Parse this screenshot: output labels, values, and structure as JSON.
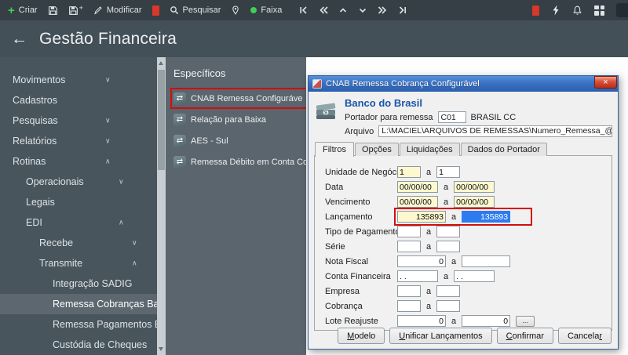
{
  "colors": {
    "toolbar-bg": "#353f45",
    "header-bg": "#445058",
    "sidebar-bg": "#49555d",
    "selected-bg": "#5c676f",
    "panel-bg": "#5b656d",
    "annotation": "#d40c0c",
    "selection": "#2e7bf0",
    "tint": "#fdf8cf",
    "bank-blue": "#1a55a8",
    "green": "#3ecf57",
    "red-badge": "#d8372a"
  },
  "icons": {
    "plus": "+",
    "back": "←",
    "close": "×",
    "chevron_down": "∨",
    "chevron_up": "∧",
    "transfer": "⇄"
  },
  "toolbar": {
    "criar": "Criar",
    "modificar": "Modificar",
    "pesquisar": "Pesquisar",
    "faixa": "Faixa"
  },
  "header": {
    "title": "Gestão Financeira"
  },
  "sidebar": {
    "items": [
      {
        "label": "Movimentos",
        "level": 0,
        "chevron": "down",
        "selected": false
      },
      {
        "label": "Cadastros",
        "level": 0,
        "chevron": "",
        "selected": false
      },
      {
        "label": "Pesquisas",
        "level": 0,
        "chevron": "down",
        "selected": false
      },
      {
        "label": "Relatórios",
        "level": 0,
        "chevron": "down",
        "selected": false
      },
      {
        "label": "Rotinas",
        "level": 0,
        "chevron": "up",
        "selected": false
      },
      {
        "label": "Operacionais",
        "level": 1,
        "chevron": "down",
        "selected": false
      },
      {
        "label": "Legais",
        "level": 1,
        "chevron": "",
        "selected": false
      },
      {
        "label": "EDI",
        "level": 1,
        "chevron": "up",
        "selected": false
      },
      {
        "label": "Recebe",
        "level": 2,
        "chevron": "down",
        "selected": false
      },
      {
        "label": "Transmite",
        "level": 2,
        "chevron": "up",
        "selected": false
      },
      {
        "label": "Integração SADIG",
        "level": 3,
        "chevron": "",
        "selected": false
      },
      {
        "label": "Remessa Cobranças Bancár",
        "level": 3,
        "chevron": "",
        "selected": true
      },
      {
        "label": "Remessa Pagamentos Banca",
        "level": 3,
        "chevron": "",
        "selected": false
      },
      {
        "label": "Custódia de Cheques",
        "level": 3,
        "chevron": "",
        "selected": false
      }
    ]
  },
  "specificos": {
    "title": "Específicos",
    "items": [
      {
        "label": "CNAB Remessa Configurável",
        "annotated": true
      },
      {
        "label": "Relação para Baixa",
        "annotated": false
      },
      {
        "label": "AES - Sul",
        "annotated": false
      },
      {
        "label": "Remessa Débito em Conta Configurável",
        "annotated": false
      }
    ]
  },
  "dialog": {
    "title": "CNAB Remessa Cobrança Configurável",
    "bank": "Banco do Brasil",
    "portador_label": "Portador para remessa",
    "portador_code": "C01",
    "portador_desc": "BRASIL CC",
    "arquivo_label": "Arquivo",
    "arquivo_value": "L:\\MACIEL\\ARQUIVOS DE REMESSAS\\Numero_Remessa_@R_Código_Banco_@B_Data_@Dddmmaa@",
    "tabs": [
      {
        "label": "Filtros",
        "active": true
      },
      {
        "label": "Opções",
        "active": false
      },
      {
        "label": "Liquidações",
        "active": false
      },
      {
        "label": "Dados do Portador",
        "active": false
      }
    ],
    "range_sep": "a",
    "browse_label": "...",
    "rows": [
      {
        "label": "Unidade de Negócio",
        "v1": "1",
        "v2": "1",
        "size": "xs",
        "tint1": true
      },
      {
        "label": "Data",
        "v1": "00/00/00",
        "v2": "00/00/00",
        "size": "sm",
        "tint1": true,
        "tint2": true
      },
      {
        "label": "Vencimento",
        "v1": "00/00/00",
        "v2": "00/00/00",
        "size": "sm",
        "tint1": true,
        "tint2": true
      },
      {
        "label": "Lançamento",
        "v1": "135893",
        "v2": "135893",
        "size": "md",
        "align": "right",
        "tint1": true,
        "selected2": true,
        "annotated": true
      },
      {
        "label": "Tipo de Pagamento",
        "v1": "",
        "v2": "",
        "size": "xs"
      },
      {
        "label": "Série",
        "v1": "",
        "v2": "",
        "size": "xs"
      },
      {
        "label": "Nota Fiscal",
        "v1": "0",
        "v2": "",
        "size": "md",
        "align": "right"
      },
      {
        "label": "Conta Financeira",
        "v1": ". .",
        "v2": ". .",
        "size": "sm"
      },
      {
        "label": "Empresa",
        "v1": "",
        "v2": "",
        "size": "xs"
      },
      {
        "label": "Cobrança",
        "v1": "",
        "v2": "",
        "size": "xs"
      },
      {
        "label": "Lote Reajuste",
        "v1": "0",
        "v2": "0",
        "size": "md",
        "align": "right",
        "browse": true
      }
    ],
    "buttons": [
      {
        "label": "Modelo",
        "accel": 0
      },
      {
        "label": "Unificar Lançamentos",
        "accel": 0
      },
      {
        "label": "Confirmar",
        "accel": 0
      },
      {
        "label": "Cancelar",
        "accel": 7
      }
    ]
  }
}
